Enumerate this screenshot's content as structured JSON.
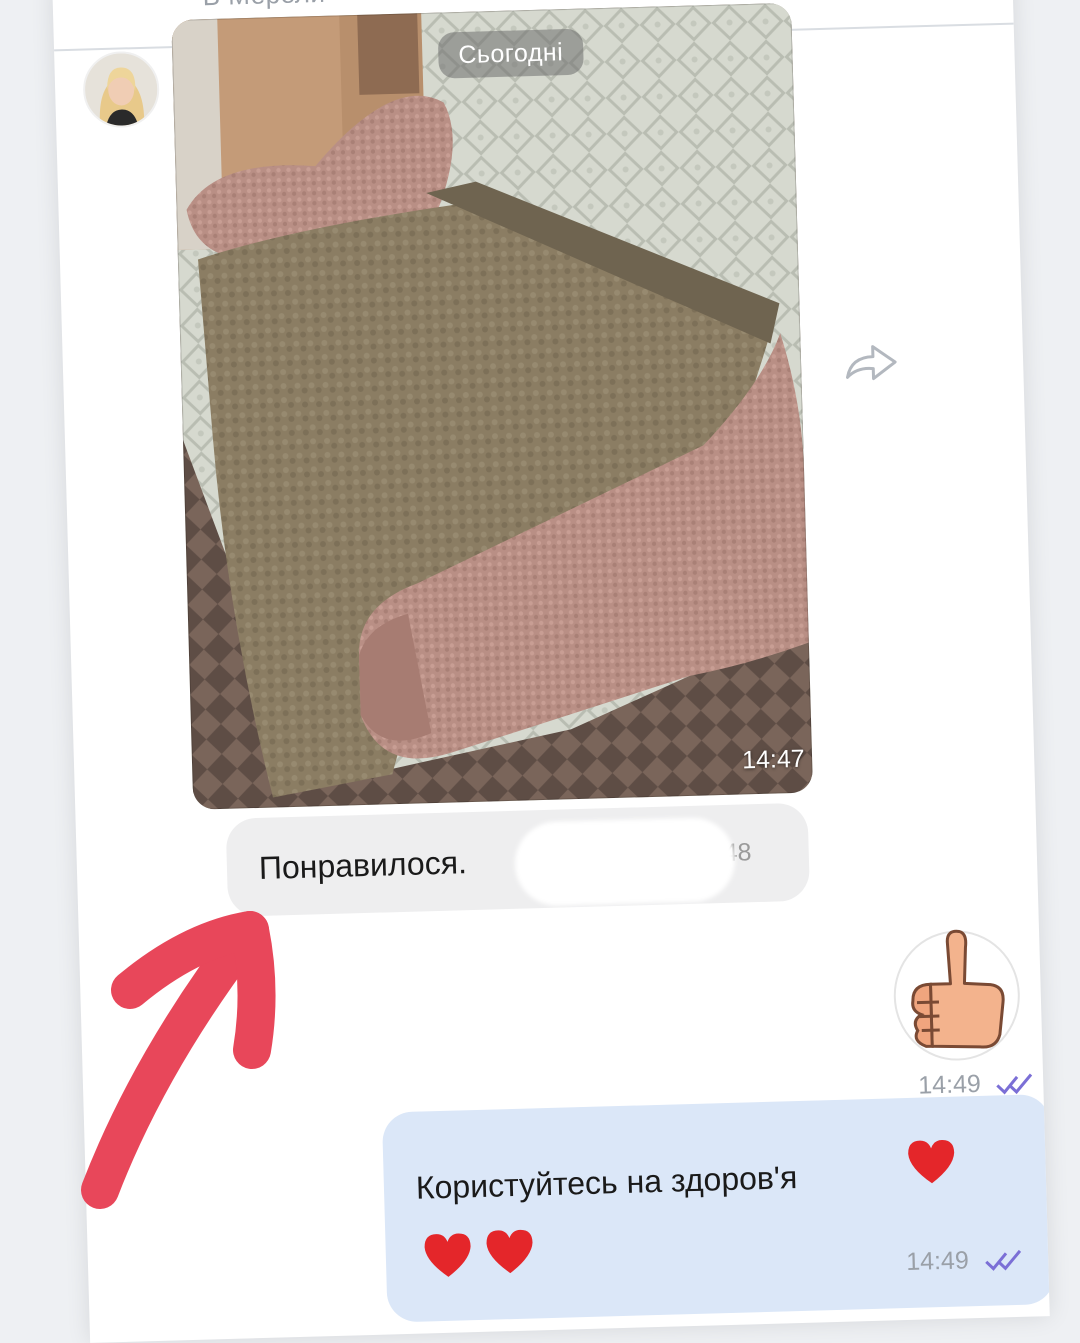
{
  "header": {
    "contact_partial": "В Мерели"
  },
  "photo_message": {
    "date_chip": "Сьогодні",
    "time": "14:47"
  },
  "incoming_message": {
    "text": "Понравилося.",
    "time_partial": ".48"
  },
  "sticker_message": {
    "sticker_icon": "thumbs-up-sticker",
    "time": "14:49",
    "status_icon": "double-check-icon"
  },
  "outgoing_message": {
    "text": "Користуйтесь на здоров'я",
    "emoji": [
      "heart",
      "heart",
      "heart"
    ],
    "time": "14:49",
    "status_icon": "double-check-icon"
  },
  "colors": {
    "incoming_bubble": "#eeeeef",
    "outgoing_bubble": "#dbe7f8",
    "read_ticks": "#7b6fd6",
    "annotation": "#e8475a",
    "heart": "#e4262a"
  }
}
